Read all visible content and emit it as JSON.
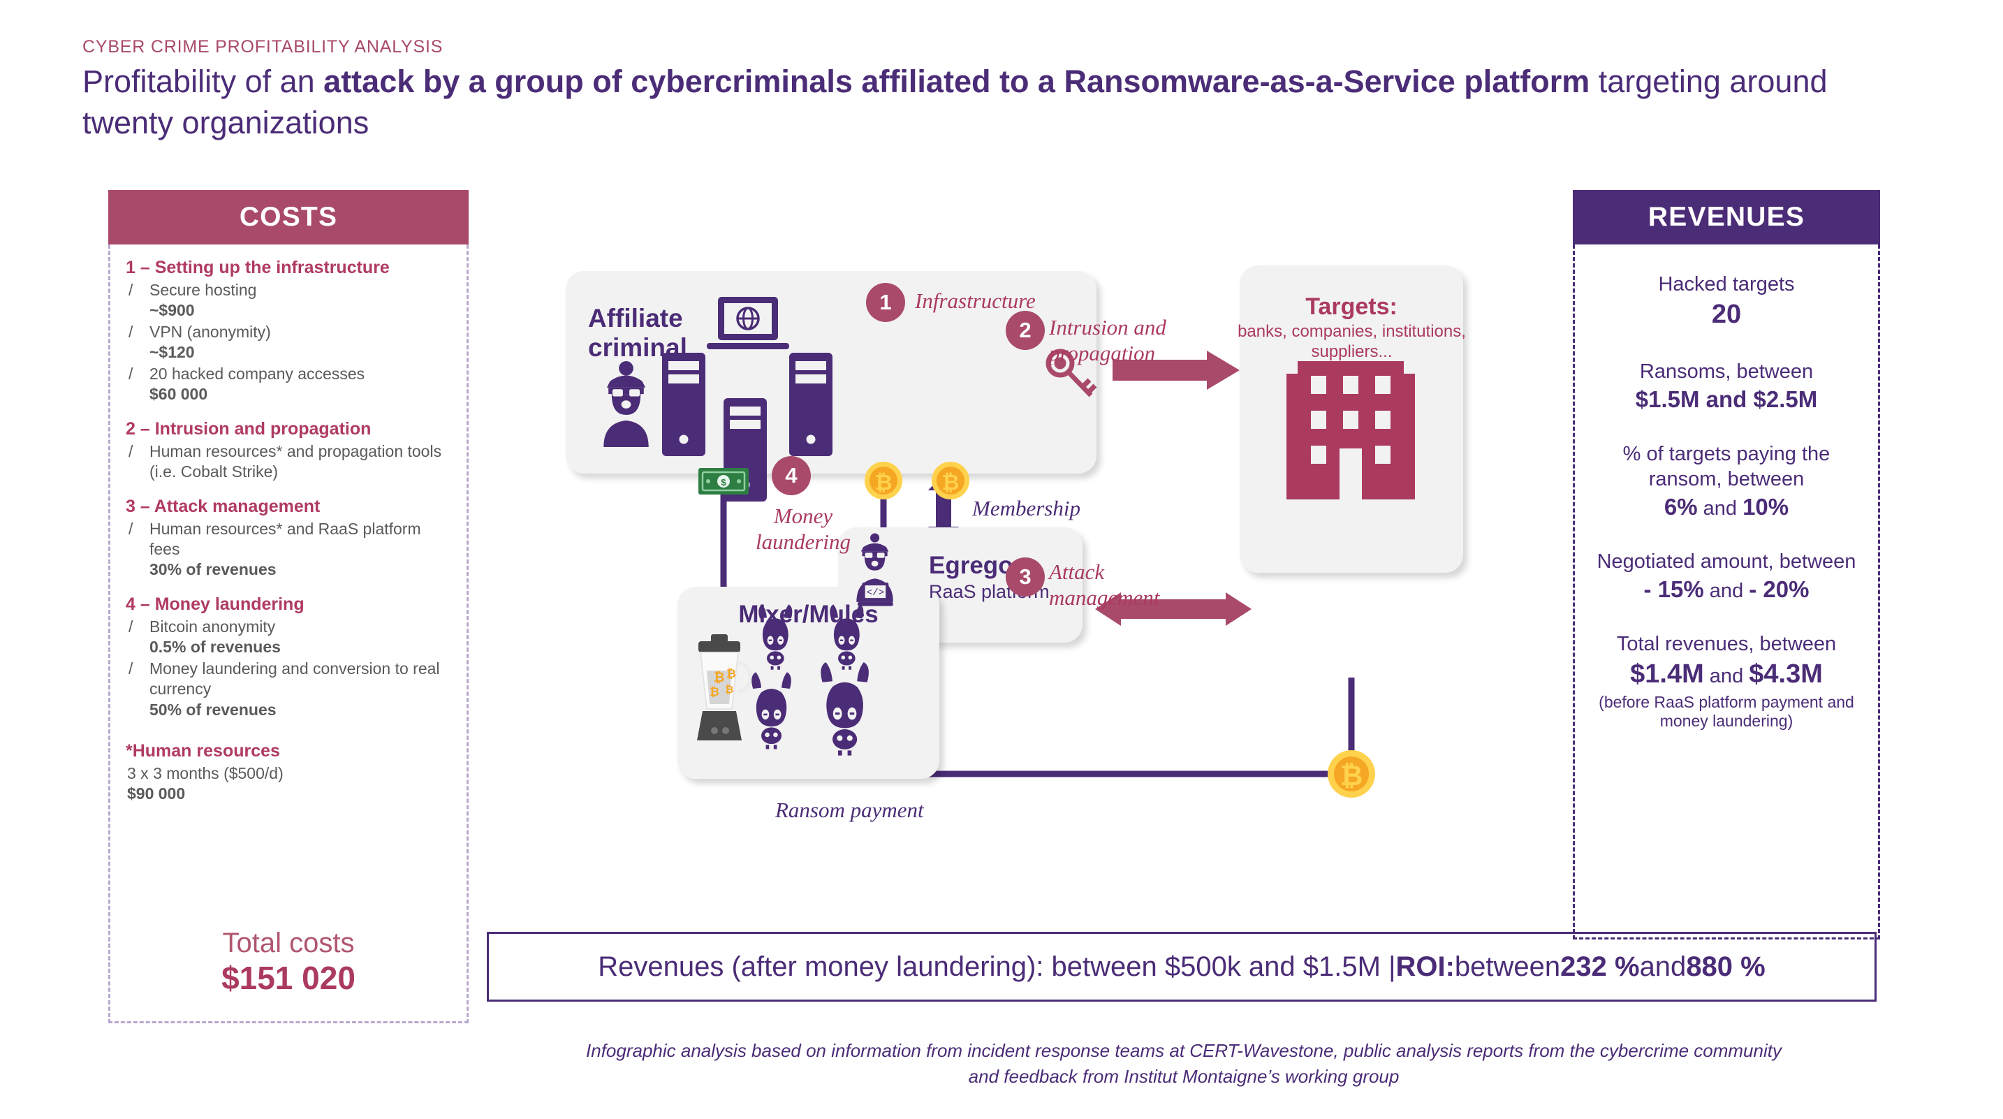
{
  "header": {
    "eyebrow": "CYBER CRIME PROFITABILITY ANALYSIS",
    "title_part1": "Profitability of an ",
    "title_bold1": "attack by a group of cybercriminals affiliated to a Ransomware-as-a-Service platform",
    "title_part2": " targeting around twenty organizations"
  },
  "costs": {
    "header": "COSTS",
    "sections": [
      {
        "title": "1 – Setting up the infrastructure",
        "items": [
          {
            "bullet": "/",
            "label": "Secure hosting",
            "value": "~$900"
          },
          {
            "bullet": "/",
            "label": "VPN (anonymity)",
            "value": "~$120"
          },
          {
            "bullet": "/",
            "label": "20 hacked company accesses",
            "value": "$60 000"
          }
        ]
      },
      {
        "title": "2 – Intrusion and propagation",
        "items": [
          {
            "bullet": "/",
            "label": "Human resources* and propagation tools (i.e. Cobalt Strike)",
            "value": ""
          }
        ]
      },
      {
        "title": "3 – Attack management",
        "items": [
          {
            "bullet": "/",
            "label": "Human resources* and RaaS platform fees",
            "value": "30% of revenues"
          }
        ]
      },
      {
        "title": "4 – Money laundering",
        "items": [
          {
            "bullet": "/",
            "label": "Bitcoin anonymity",
            "value": "0.5% of revenues"
          },
          {
            "bullet": "/",
            "label": "Money laundering and conversion to real currency",
            "value": "50% of revenues"
          }
        ]
      }
    ],
    "hr_note": {
      "title": "*Human resources",
      "line": "3  x 3 months ($500/d)",
      "amount": "$90 000"
    },
    "total_label": "Total costs",
    "total_value": "$151 020"
  },
  "revenues": {
    "header": "REVENUES",
    "blocks": [
      {
        "label": "Hacked targets",
        "value": "20",
        "sub": ""
      },
      {
        "label": "Ransoms, between",
        "value": "$1.5M and $2.5M",
        "sub": ""
      },
      {
        "label": "% of targets paying the ransom, between",
        "value_pre": "6%",
        "value_mid": " and ",
        "value_post": "10%",
        "sub": ""
      },
      {
        "label": "Negotiated amount, between",
        "value_pre": "- 15%",
        "value_mid": " and ",
        "value_post": "- 20%",
        "sub": ""
      },
      {
        "label": "Total revenues, between",
        "value_pre": "$1.4M",
        "value_mid": " and ",
        "value_post": "$4.3M",
        "sub": "(before RaaS platform payment and money laundering)"
      }
    ]
  },
  "diagram": {
    "affiliate_title": "Affiliate\ncriminal",
    "targets_title": "Targets:",
    "targets_sub": "banks, companies, institutions, suppliers...",
    "egregor_title": "Egregor",
    "egregor_sub": "RaaS platform",
    "mixer_title": "Mixer/Mules",
    "badge1": "1",
    "badge2": "2",
    "badge3": "3",
    "badge4": "4",
    "label1": "Infrastructure",
    "label2": "Intrusion and propagation",
    "label3": "Attack management",
    "label4": "Money laundering",
    "label_membership": "Membership",
    "label_ransom": "Ransom payment"
  },
  "banner": {
    "text_pre": "Revenues (after money laundering): between $500k and $1.5M | ",
    "roi_label": "ROI:",
    "text_mid": " between ",
    "roi_low": "232 %",
    "text_and": " and ",
    "roi_high": "880 %"
  },
  "footer": {
    "line1": "Infographic analysis based on information from incident response teams at CERT-Wavestone, public analysis reports from the cybercrime community",
    "line2": "and feedback from Institut Montaigne’s working group"
  },
  "colors": {
    "purple": "#4b2c77",
    "crimson": "#a94a6b",
    "crimson_dark": "#ab3a5f",
    "card_grey": "#f2f2f2",
    "bitcoin_orange": "#f5a623",
    "bitcoin_yellow": "#ffd24d",
    "money_green": "#2e7d42"
  }
}
